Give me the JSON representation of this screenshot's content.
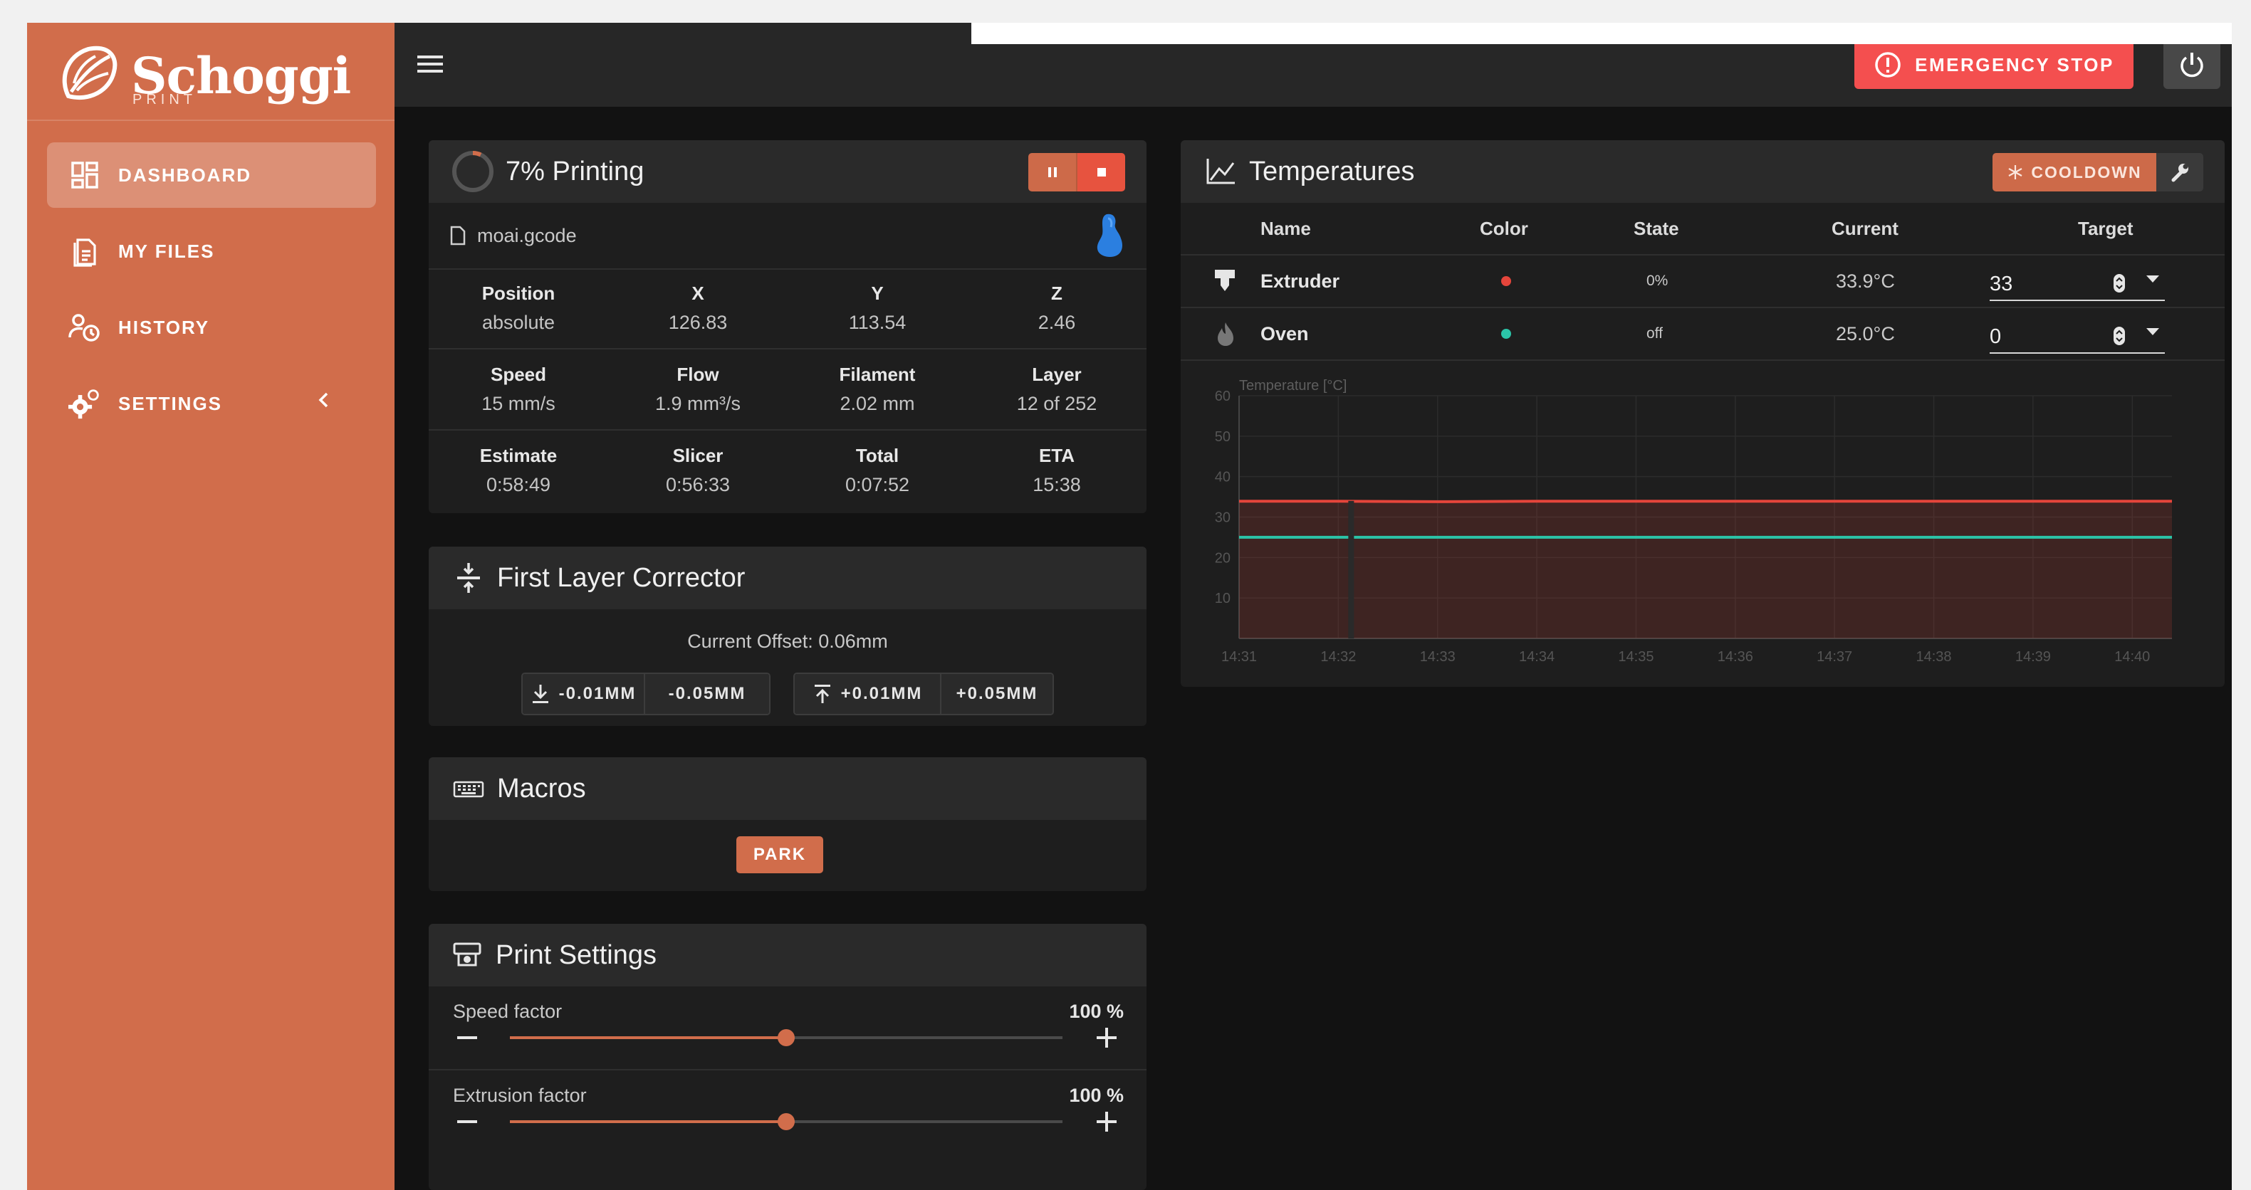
{
  "app": {
    "logo_name": "Schoggi",
    "logo_sub": "PRINT"
  },
  "sidebar": {
    "items": [
      {
        "label": "DASHBOARD",
        "icon": "dashboard-icon",
        "active": true
      },
      {
        "label": "MY FILES",
        "icon": "files-icon",
        "active": false
      },
      {
        "label": "HISTORY",
        "icon": "history-icon",
        "active": false
      },
      {
        "label": "SETTINGS",
        "icon": "settings-icon",
        "active": false
      }
    ]
  },
  "topbar": {
    "emergency_stop_label": "EMERGENCY STOP"
  },
  "colors": {
    "brand": "#d16d4b",
    "danger": "#f44f4f",
    "extruder": "#e5453b",
    "oven": "#2bc4a8",
    "background": "#121212"
  },
  "print_status": {
    "title": "7% Printing",
    "progress": 0.07,
    "file_name": "moai.gcode",
    "stats": [
      [
        {
          "label": "Position",
          "value": "absolute"
        },
        {
          "label": "X",
          "value": "126.83"
        },
        {
          "label": "Y",
          "value": "113.54"
        },
        {
          "label": "Z",
          "value": "2.46"
        }
      ],
      [
        {
          "label": "Speed",
          "value": "15 mm/s"
        },
        {
          "label": "Flow",
          "value": "1.9 mm³/s"
        },
        {
          "label": "Filament",
          "value": "2.02 mm"
        },
        {
          "label": "Layer",
          "value": "12 of 252"
        }
      ],
      [
        {
          "label": "Estimate",
          "value": "0:58:49"
        },
        {
          "label": "Slicer",
          "value": "0:56:33"
        },
        {
          "label": "Total",
          "value": "0:07:52"
        },
        {
          "label": "ETA",
          "value": "15:38"
        }
      ]
    ]
  },
  "first_layer": {
    "title": "First Layer Corrector",
    "offset_text": "Current Offset: 0.06mm",
    "down_small": "-0.01MM",
    "down_large": "-0.05MM",
    "up_small": "+0.01MM",
    "up_large": "+0.05MM"
  },
  "macros": {
    "title": "Macros",
    "park_label": "PARK"
  },
  "print_settings": {
    "title": "Print Settings",
    "speed_label": "Speed factor",
    "speed_value": "100 %",
    "speed_level": 0.5,
    "extrusion_label": "Extrusion factor",
    "extrusion_value": "100 %",
    "extrusion_level": 0.5
  },
  "temperatures": {
    "title": "Temperatures",
    "cooldown_label": "COOLDOWN",
    "columns": [
      "Name",
      "Color",
      "State",
      "Current",
      "Target"
    ],
    "rows": [
      {
        "name": "Extruder",
        "color": "#e5453b",
        "state": "0%",
        "current": "33.9°C",
        "target": "33",
        "icon": "extruder-icon"
      },
      {
        "name": "Oven",
        "color": "#2bc4a8",
        "state": "off",
        "current": "25.0°C",
        "target": "0",
        "icon": "fire-icon"
      }
    ]
  },
  "chart_data": {
    "type": "line",
    "ylabel": "Temperature [°C]",
    "xlabel": "",
    "ylim": [
      0,
      60
    ],
    "yticks": [
      "10",
      "20",
      "30",
      "40",
      "50",
      "60"
    ],
    "x": [
      "14:31",
      "14:32",
      "14:33",
      "14:34",
      "14:35",
      "14:36",
      "14:37",
      "14:38",
      "14:39",
      "14:40"
    ],
    "series": [
      {
        "name": "Extruder",
        "color": "#e5453b",
        "values": [
          33.9,
          33.9,
          33.8,
          33.9,
          33.9,
          33.9,
          33.9,
          33.9,
          33.9,
          33.9
        ]
      },
      {
        "name": "Oven",
        "color": "#2bc4a8",
        "values": [
          25.0,
          25.0,
          25.0,
          25.0,
          25.0,
          25.0,
          25.0,
          25.0,
          25.0,
          25.0
        ]
      }
    ],
    "grid": true
  }
}
